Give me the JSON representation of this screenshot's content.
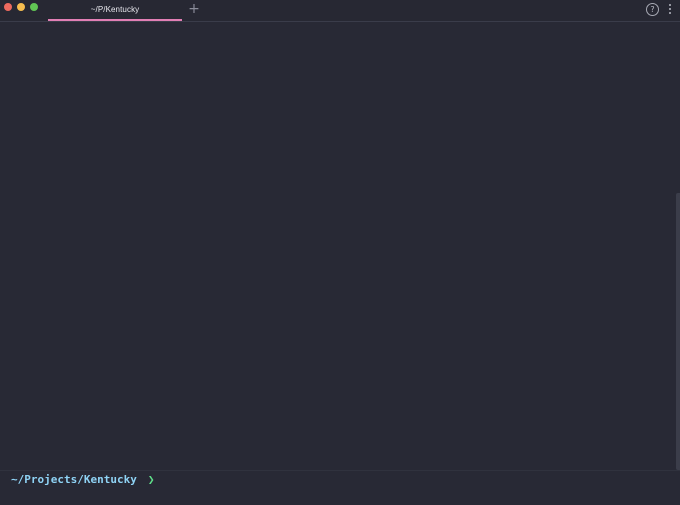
{
  "window": {
    "tab_title": "~/P/Kentucky",
    "new_tab_symbol": "+",
    "help_symbol": "?"
  },
  "terminal": {
    "prompt_path": "~/Projects/Kentucky",
    "prompt_symbol": "❯"
  },
  "colors": {
    "background": "#282935",
    "close": "#ee6a5f",
    "minimize": "#f5bd4f",
    "maximize": "#61c554",
    "tab_underline": "#e27fb5",
    "prompt_path": "#8fd3f5",
    "prompt_symbol": "#5fe08a"
  },
  "icons": {
    "close": "close-icon",
    "minimize": "minimize-icon",
    "maximize": "maximize-icon",
    "new_tab": "plus-icon",
    "help": "help-icon",
    "menu": "kebab-menu-icon"
  }
}
